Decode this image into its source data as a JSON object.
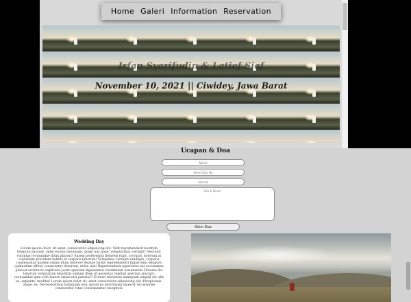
{
  "nav": {
    "items": [
      "Home",
      "Galeri",
      "Information",
      "Reservation"
    ]
  },
  "hero": {
    "names": "Irfan Syarifudin & Latief Siaf",
    "date": "November 10, 2021 || Ciwidey, Jawa Barat"
  },
  "ucapan": {
    "title": "Ucapan & Doa",
    "name_placeholder": "Name",
    "email_placeholder": "Email atau No",
    "address_placeholder": "Alamat",
    "message_placeholder": "Doa & Pesan",
    "submit_label": "Kirim Doa"
  },
  "wedding": {
    "title": "Wedding Day",
    "text": "Lorem ipsum dolor, sit amet, consectetur adipisicing elit. Velit reprehenderit nostrum tempora suscipit, optio earum numquam, quam nisi quae, voluptatibus corrupti! Nesciunt voluptas recusandae illum placeat? Autem perferendis dolorem fugit, corrupti, dolorum at cupiditate provident debitis id corporis laborum! Voluptates corrupti similique, corporis consequatur quidem omnis illum dolores? Beatae facilis reprehenderit fugiat eum tempore quibusdam officia consectetur deserunt, dolor, nisi! Reprehenderit asperiores aut accusamus placeat architecto explicabo porro aperiam dignissimos laudantium assumenda. Dolores illo laborum voluptatum blanditiis veniam illum et possimus repellat aperiam suscipit, recusandae quia velit labore omnis nisi pariatur? Eveniet molestias numquam aliquid vel odit ea, sapiente, mollitia! Lorem ipsum dolor sit, amet consectetur adipisicing elit. Perspiciatis, atque, ex. Necessitatibus numquam non, ipsum ea laboriosam quaerat recusandae consectetur vitae consequuntur excepturi."
  },
  "colors": {
    "page_background": "#d3d3d3",
    "frame_background": "#000000",
    "card_background": "#ffffff"
  },
  "icons": [
    "couple-photo",
    "landscape-photo"
  ]
}
